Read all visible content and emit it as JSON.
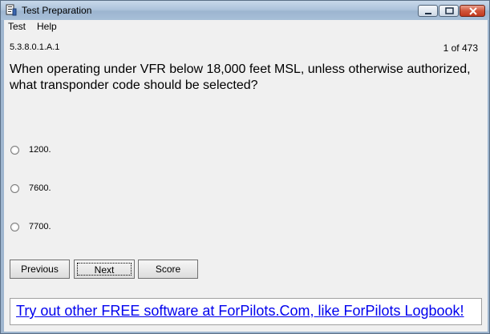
{
  "window": {
    "title": "Test Preparation"
  },
  "menu": {
    "items": [
      "Test",
      "Help"
    ]
  },
  "question": {
    "id": "5.3.8.0.1.A.1",
    "counter": "1 of 473",
    "text": "When operating under VFR below 18,000 feet MSL, unless otherwise authorized, what transponder code should be selected?",
    "options": [
      "1200.",
      "7600.",
      "7700."
    ]
  },
  "buttons": {
    "previous": "Previous",
    "next": "Next",
    "score": "Score"
  },
  "banner": {
    "text": "Try out other FREE software at ForPilots.Com, like ForPilots Logbook!"
  },
  "colors": {
    "link": "#0000ee",
    "titlebar": "#aec4dc",
    "client": "#f0f0f0"
  }
}
